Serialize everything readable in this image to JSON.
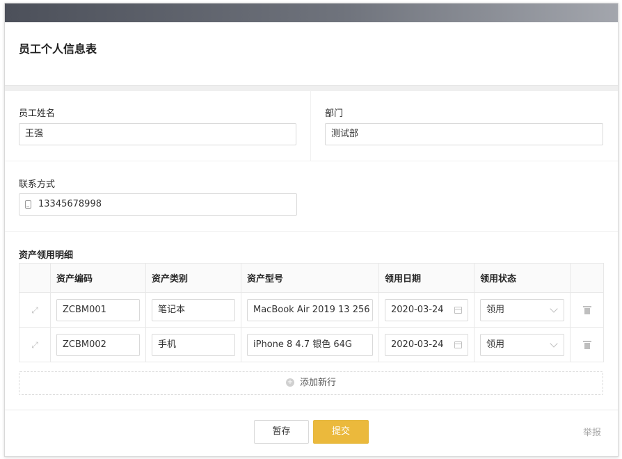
{
  "form": {
    "title": "员工个人信息表",
    "employee_name": {
      "label": "员工姓名",
      "value": "王强"
    },
    "department": {
      "label": "部门",
      "value": "测试部"
    },
    "contact": {
      "label": "联系方式",
      "value": "13345678998",
      "icon": "phone-icon"
    },
    "assets": {
      "section_label": "资产领用明细",
      "columns": [
        "资产编码",
        "资产类别",
        "资产型号",
        "领用日期",
        "领用状态"
      ],
      "rows": [
        {
          "code": "ZCBM001",
          "category": "笔记本",
          "model": "MacBook Air 2019 13 256",
          "date": "2020-03-24",
          "status": "领用"
        },
        {
          "code": "ZCBM002",
          "category": "手机",
          "model": "iPhone 8 4.7 银色 64G",
          "date": "2020-03-24",
          "status": "领用"
        }
      ],
      "add_row_label": "添加新行"
    },
    "buttons": {
      "save": "暂存",
      "submit": "提交"
    },
    "report_link": "举报"
  },
  "colors": {
    "accent": "#ebb93c",
    "topbar": "#5a5e67"
  }
}
